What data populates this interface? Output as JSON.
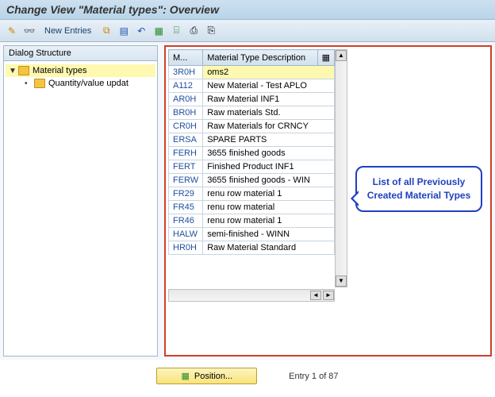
{
  "window": {
    "title": "Change View \"Material types\": Overview"
  },
  "toolbar": {
    "new_entries": "New Entries"
  },
  "dialog_structure": {
    "header": "Dialog Structure",
    "items": [
      {
        "label": "Material types",
        "selected": true
      },
      {
        "label": "Quantity/value updat",
        "selected": false
      }
    ]
  },
  "table": {
    "col_code": "M...",
    "col_desc": "Material Type Description",
    "rows": [
      {
        "code": "3R0H",
        "desc": "oms2",
        "highlight": true
      },
      {
        "code": "A112",
        "desc": "New Material - Test APLO"
      },
      {
        "code": "AR0H",
        "desc": "Raw Material INF1"
      },
      {
        "code": "BR0H",
        "desc": "Raw materials Std."
      },
      {
        "code": "CR0H",
        "desc": "Raw Materials for CRNCY"
      },
      {
        "code": "ERSA",
        "desc": "SPARE PARTS"
      },
      {
        "code": "FERH",
        "desc": "3655 finished goods"
      },
      {
        "code": "FERT",
        "desc": "Finished Product INF1"
      },
      {
        "code": "FERW",
        "desc": "3655 finished goods - WIN"
      },
      {
        "code": "FR29",
        "desc": "renu row material 1"
      },
      {
        "code": "FR45",
        "desc": "renu row material"
      },
      {
        "code": "FR46",
        "desc": "renu row material 1"
      },
      {
        "code": "HALW",
        "desc": "semi-finished - WINN"
      },
      {
        "code": "HR0H",
        "desc": "Raw Material Standard"
      }
    ]
  },
  "callout": {
    "text": "List of all Previously Created Material Types"
  },
  "footer": {
    "position_label": "Position...",
    "entry_text": "Entry 1 of 87"
  }
}
